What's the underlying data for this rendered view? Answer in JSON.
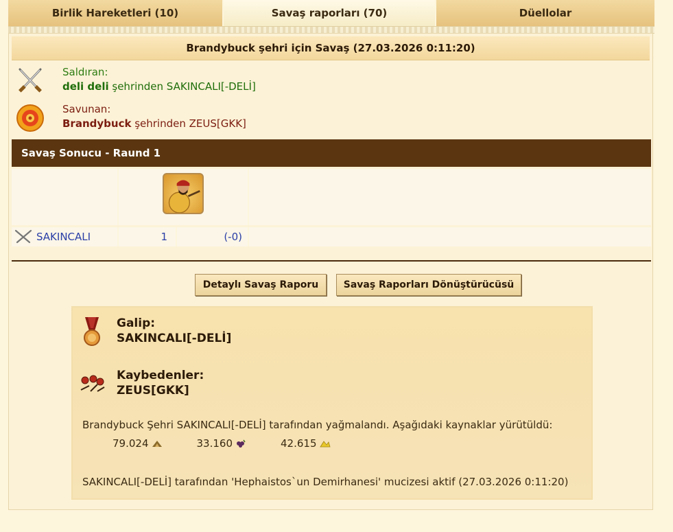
{
  "tabs": [
    {
      "label": "Birlik Hareketleri (10)"
    },
    {
      "label": "Savaş raporları (70)"
    },
    {
      "label": "Düellolar"
    }
  ],
  "report": {
    "title": "Brandybuck şehri için Savaş (27.03.2026 0:11:20)",
    "attacker": {
      "label": "Saldıran:",
      "city": "deli deli",
      "text": " şehrinden SAKINCALI[-DELİ]"
    },
    "defender": {
      "label": "Savunan:",
      "city": "Brandybuck",
      "text": " şehrinden ZEUS[GKK]"
    },
    "round_title": "Savaş Sonucu - Raund 1",
    "unit_row": {
      "player": "SAKINCALI",
      "count": "1",
      "loss": "(-0)"
    }
  },
  "buttons": {
    "detailed": "Detaylı Savaş Raporu",
    "converter": "Savaş Raporları Dönüştürücüsü"
  },
  "result": {
    "winner_label": "Galip:",
    "winner_name": "SAKINCALI[-DELİ]",
    "loser_label": "Kaybedenler:",
    "loser_name": "ZEUS[GKK]",
    "plunder_text": "Brandybuck Şehri SAKINCALI[-DELİ] tarafından yağmalandı. Aşağıdaki kaynaklar yürütüldü:",
    "resources": [
      {
        "value": "79.024",
        "icon": "wood-icon"
      },
      {
        "value": "33.160",
        "icon": "wine-icon"
      },
      {
        "value": "42.615",
        "icon": "sulfur-icon"
      }
    ],
    "wonder_text": "SAKINCALI[-DELİ] tarafından 'Hephaistos`un Demirhanesi' mucizesi aktif (27.03.2026 0:11:20)"
  }
}
